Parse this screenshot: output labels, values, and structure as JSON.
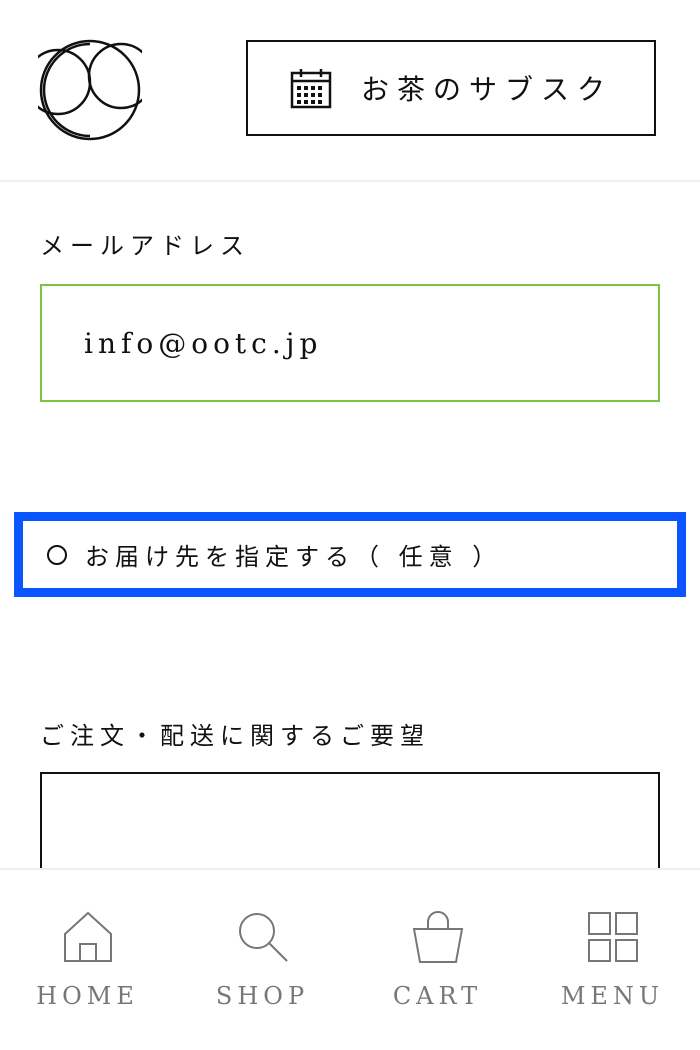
{
  "header": {
    "subscribe_label": "お茶のサブスク"
  },
  "form": {
    "email_label": "メールアドレス",
    "email_value": "info@ootc.jp",
    "delivery_option_label": "お届け先を指定する（ 任意 ）",
    "request_label": "ご注文・配送に関するご要望",
    "request_value": ""
  },
  "nav": {
    "items": [
      {
        "label": "HOME",
        "icon": "home-icon"
      },
      {
        "label": "SHOP",
        "icon": "search-icon"
      },
      {
        "label": "CART",
        "icon": "cart-icon"
      },
      {
        "label": "MENU",
        "icon": "menu-grid-icon"
      }
    ]
  },
  "colors": {
    "accent_focus": "#0a55ff",
    "input_valid_border": "#7bc442",
    "nav_text": "#777777"
  }
}
